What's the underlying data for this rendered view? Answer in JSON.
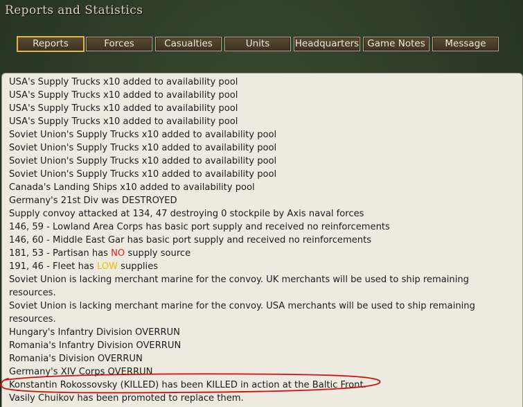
{
  "window": {
    "title": "Reports and Statistics"
  },
  "tabs": [
    {
      "label": "Reports",
      "active": true
    },
    {
      "label": "Forces",
      "active": false
    },
    {
      "label": "Casualties",
      "active": false
    },
    {
      "label": "Units",
      "active": false
    },
    {
      "label": "Headquarters",
      "active": false
    },
    {
      "label": "Game Notes",
      "active": false
    },
    {
      "label": "Message",
      "active": false
    }
  ],
  "log": {
    "lines": [
      "USA's Supply Trucks x10 added to availability pool",
      "USA's Supply Trucks x10 added to availability pool",
      "USA's Supply Trucks x10 added to availability pool",
      "USA's Supply Trucks x10 added to availability pool",
      "Soviet Union's Supply Trucks x10 added to availability pool",
      "Soviet Union's Supply Trucks x10 added to availability pool",
      "Soviet Union's Supply Trucks x10 added to availability pool",
      "Soviet Union's Supply Trucks x10 added to availability pool",
      "Canada's Landing Ships x10 added to availability pool",
      "Germany's 21st Div was DESTROYED",
      "Supply convoy attacked at 134, 47 destroying 0 stockpile by Axis naval forces",
      "146, 59 - Lowland Area Corps has basic port supply and received no reinforcements",
      "146, 60 - Middle East Gar has basic port supply and received no reinforcements"
    ],
    "partisan": {
      "prefix": "181, 53 - Partisan has ",
      "highlight": "NO",
      "suffix": " supply source"
    },
    "fleet": {
      "prefix": "191, 46 - Fleet has ",
      "highlight": "LOW",
      "suffix": " supplies"
    },
    "lines2": [
      "Soviet Union is lacking merchant marine for the convoy. UK merchants will be used to ship remaining resources.",
      "Soviet Union is lacking merchant marine for the convoy. USA merchants will be used to ship remaining resources.",
      "Hungary's Infantry Division OVERRUN",
      "Romania's Infantry Division OVERRUN",
      "Romania's Division OVERRUN",
      "Germany's XIV Corps OVERRUN",
      "Konstantin Rokossovsky (KILLED) has been KILLED in action at the Baltic Front.",
      "Vasily Chuikov has been promoted to replace them."
    ],
    "highlight_colors": {
      "no": "#e41a1a",
      "low": "#e6c200"
    },
    "annotation_color": "#d01010"
  }
}
